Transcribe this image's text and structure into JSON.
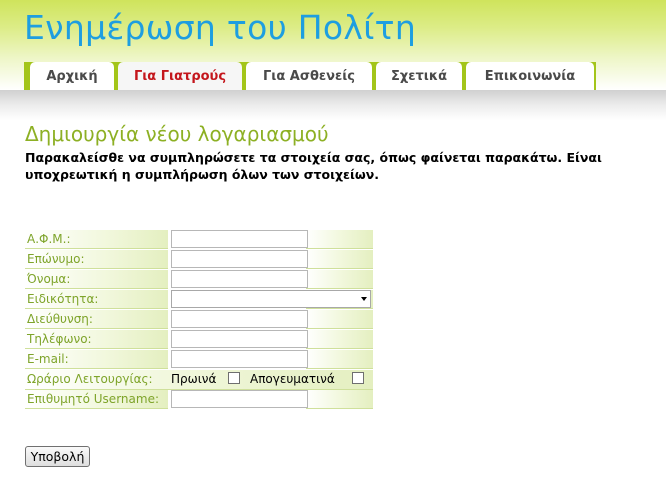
{
  "header": {
    "site_title": "Ενημέρωση του Πολίτη"
  },
  "nav": {
    "tabs": [
      {
        "label": "Αρχική",
        "active": false
      },
      {
        "label": "Για Γιατρούς",
        "active": true
      },
      {
        "label": "Για Ασθενείς",
        "active": false
      },
      {
        "label": "Σχετικά",
        "active": false
      },
      {
        "label": "Επικοινωνία",
        "active": false
      }
    ]
  },
  "main": {
    "title": "Δημιουργία νέου λογαριασμού",
    "intro": "Παρακαλείσθε να συμπληρώσετε τα στοιχεία σας, όπως φαίνεται παρακάτω. Είναι υποχρεωτική η συμπλήρωση όλων των στοιχείων."
  },
  "form": {
    "afm_label": "Α.Φ.Μ.:",
    "afm_value": "",
    "surname_label": "Επώνυμο:",
    "surname_value": "",
    "name_label": "Όνομα:",
    "name_value": "",
    "specialty_label": "Ειδικότητα:",
    "specialty_selected": "",
    "address_label": "Διεύθυνση:",
    "address_value": "",
    "phone_label": "Τηλέφωνο:",
    "phone_value": "",
    "email_label": "E-mail:",
    "email_value": "",
    "hours_label": "Ωράριο Λειτουργίας:",
    "morning_label": "Πρωινά",
    "morning_checked": false,
    "afternoon_label": "Απογευματινά",
    "afternoon_checked": false,
    "username_label": "Επιθυμητό Username:",
    "username_value": "",
    "submit_label": "Υποβολή"
  },
  "colors": {
    "title_blue": "#1e9ee0",
    "nav_green": "#a3c51a",
    "active_tab_red": "#c4161c",
    "heading_green": "#8db024",
    "label_green": "#7ea42a"
  }
}
